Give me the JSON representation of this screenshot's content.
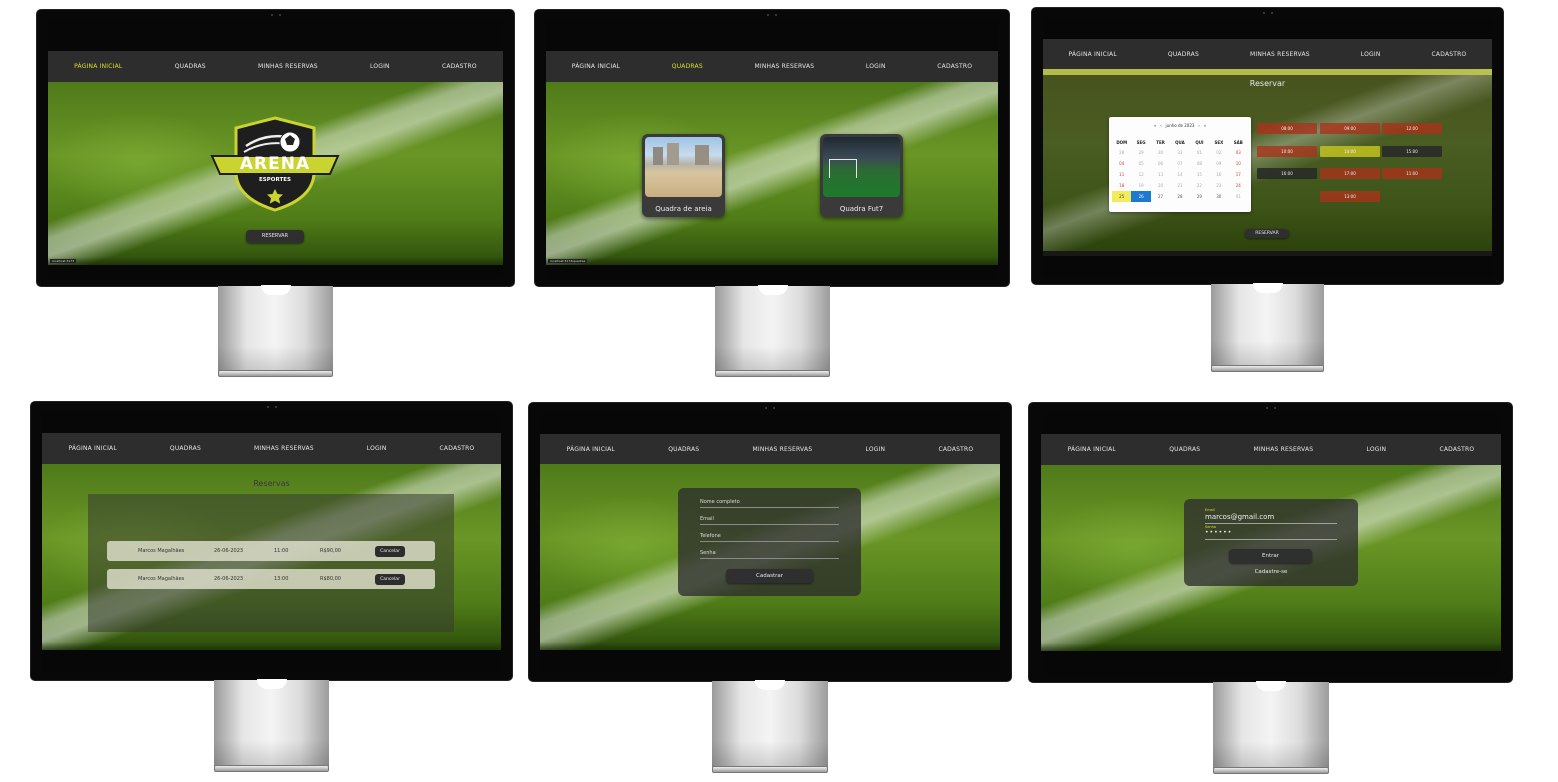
{
  "nav": {
    "home": "PÁGINA INICIAL",
    "courts": "QUADRAS",
    "my_reservations": "MINHAS RESERVAS",
    "login": "LOGIN",
    "signup": "CADASTRO"
  },
  "colors": {
    "accent": "#d6e02a",
    "nav_bg": "#2d2d2d",
    "selected_day": "#1c78d0",
    "today": "#f2ec5a",
    "slot_unavailable": "#aa3219"
  },
  "home": {
    "logo_title": "ARENA",
    "logo_subtitle": "ESPORTES",
    "reserve_button": "RESERVAR",
    "url": "localhost:3173"
  },
  "courts": {
    "items": [
      {
        "label": "Quadra de areia"
      },
      {
        "label": "Quadra Fut7"
      }
    ],
    "url": "localhost:3173/quadras"
  },
  "booking": {
    "title": "Reservar",
    "calendar": {
      "nav_prev_year": "«",
      "nav_prev": "‹",
      "month_label": "junho de 2023",
      "nav_next": "›",
      "nav_next_year": "»",
      "weekdays": [
        "DOM",
        "SEG",
        "TER",
        "QUA",
        "QUI",
        "SEX",
        "SÁB"
      ],
      "weeks": [
        [
          "28",
          "29",
          "30",
          "31",
          "01",
          "02",
          "03"
        ],
        [
          "04",
          "05",
          "06",
          "07",
          "08",
          "09",
          "10"
        ],
        [
          "11",
          "12",
          "13",
          "14",
          "15",
          "16",
          "17"
        ],
        [
          "18",
          "19",
          "20",
          "21",
          "22",
          "23",
          "24"
        ],
        [
          "25",
          "26",
          "27",
          "28",
          "29",
          "30",
          "01"
        ]
      ],
      "today": "25",
      "selected": "26"
    },
    "slots": [
      {
        "time": "08:00",
        "state": "unavailable"
      },
      {
        "time": "09:00",
        "state": "unavailable"
      },
      {
        "time": "12:00",
        "state": "unavailable"
      },
      {
        "time": "10:00",
        "state": "unavailable"
      },
      {
        "time": "14:00",
        "state": "selected"
      },
      {
        "time": "15:00",
        "state": "available"
      },
      {
        "time": "16:00",
        "state": "available"
      },
      {
        "time": "17:00",
        "state": "unavailable"
      },
      {
        "time": "11:00",
        "state": "unavailable"
      },
      {
        "time": "13:00",
        "state": "unavailable"
      }
    ],
    "reserve_button": "RESERVAR"
  },
  "reservations": {
    "title": "Reservas",
    "rows": [
      {
        "name": "Marcos Magalhães",
        "date": "26-06-2023",
        "time": "11:00",
        "price": "R$90,00",
        "cancel": "Cancelar"
      },
      {
        "name": "Marcos Magalhães",
        "date": "26-06-2023",
        "time": "13:00",
        "price": "R$80,00",
        "cancel": "Cancelar"
      }
    ]
  },
  "signup": {
    "full_name": "Nome completo",
    "email": "Email",
    "phone": "Telefone",
    "password": "Senha",
    "submit": "Cadastrar"
  },
  "login": {
    "email_label": "Email",
    "email_value": "marcos@gmail.com",
    "password_label": "Senha",
    "password_value": "••••••",
    "submit": "Entrar",
    "signup_link": "Cadastre-se"
  }
}
